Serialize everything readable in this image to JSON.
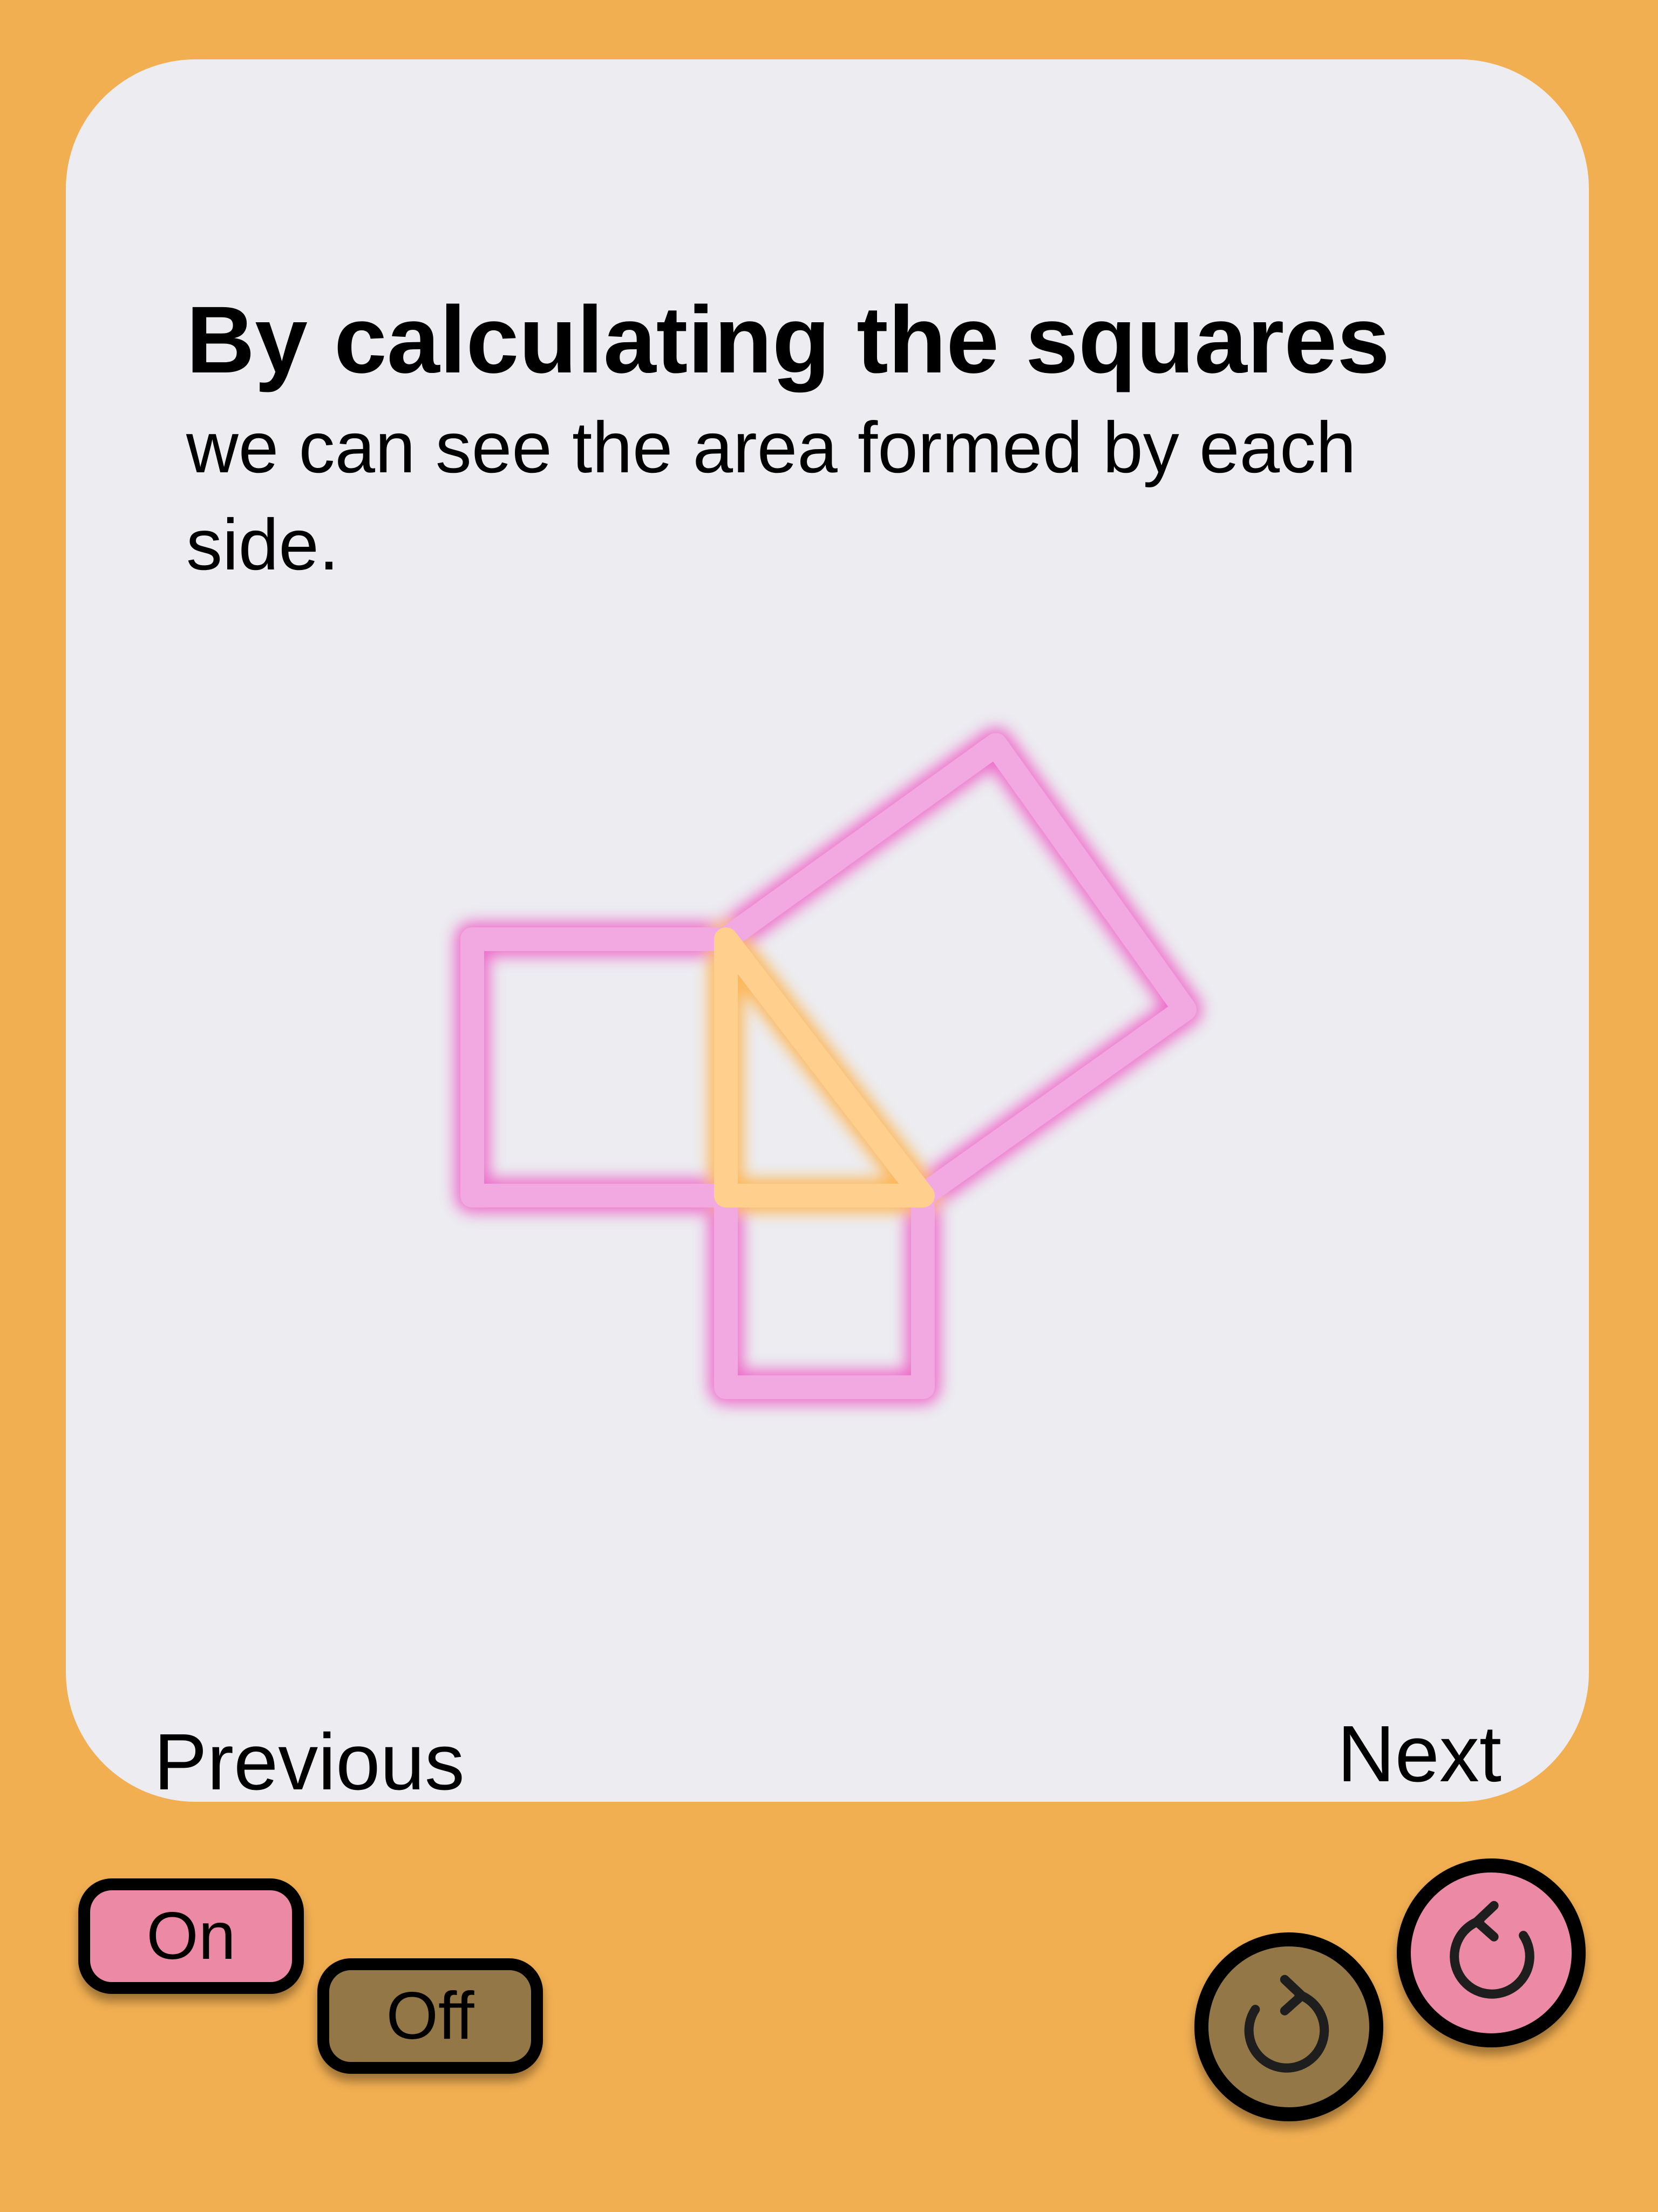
{
  "card": {
    "title": "By calculating the squares",
    "subtitle": "we can see the area formed by each side."
  },
  "diagram": {
    "square_color": "#EE5FC6",
    "triangle_color": "#FFB24A"
  },
  "navigation": {
    "previous_label": "Previous",
    "next_label": "Next"
  },
  "toggles": {
    "on_label": "On",
    "off_label": "Off",
    "on_color": "#EC89A5",
    "off_color": "#947746"
  },
  "controls": {
    "redo_icon": "redo-icon",
    "undo_icon": "undo-icon"
  },
  "colors": {
    "background": "#F2AF52",
    "card": "#ECECF1"
  }
}
